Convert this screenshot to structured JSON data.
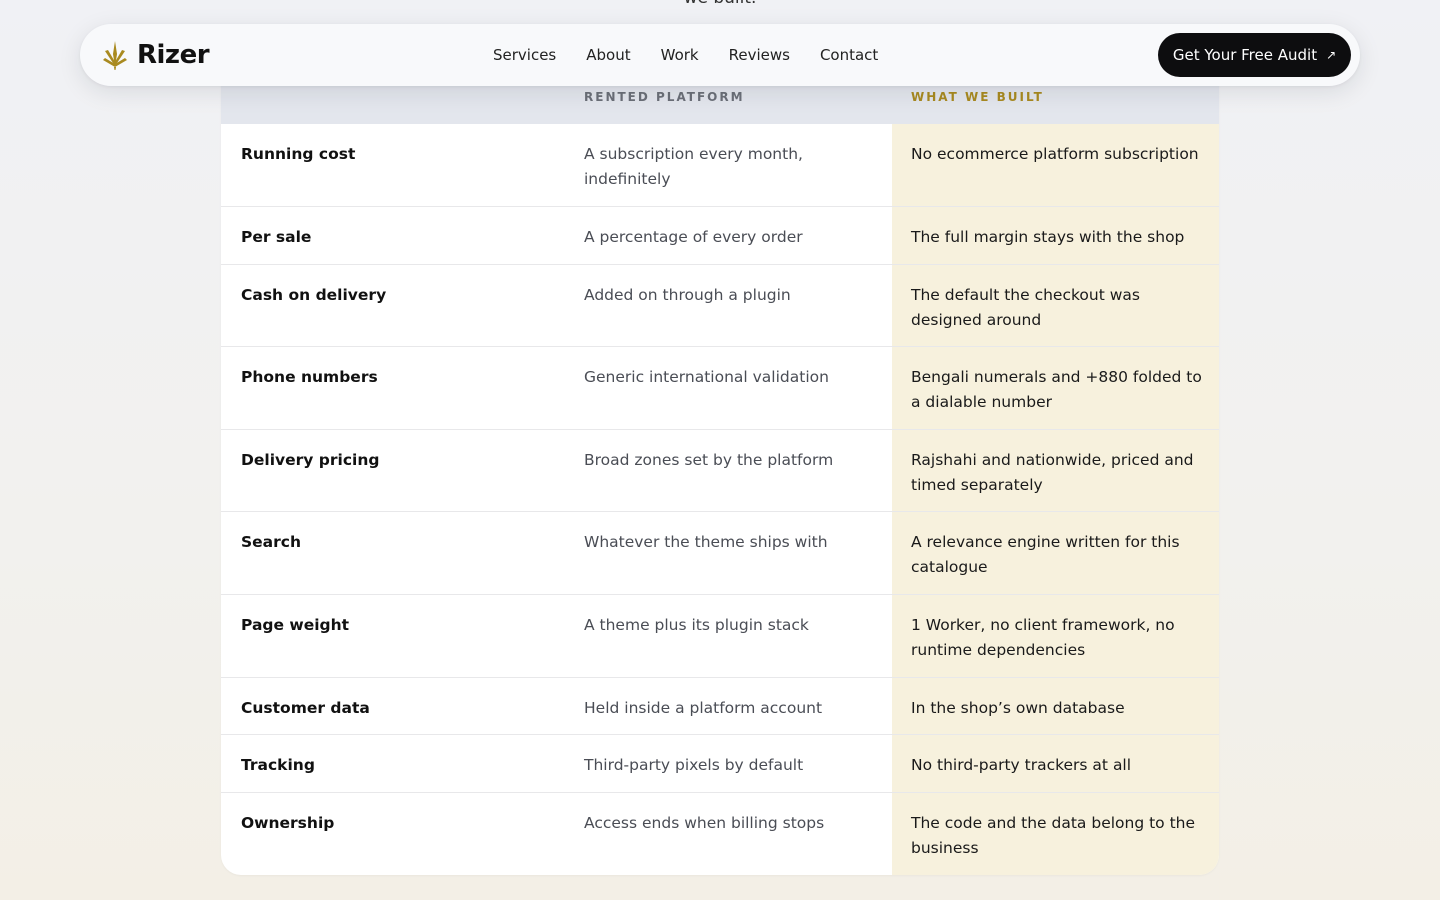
{
  "top_partial_text": "we built.",
  "navbar": {
    "brand": "Rizer",
    "links": [
      "Services",
      "About",
      "Work",
      "Reviews",
      "Contact"
    ],
    "cta_label": "Get Your Free Audit",
    "cta_icon": "arrow-up-right-icon"
  },
  "table": {
    "headers": {
      "label": "",
      "rented": "RENTED PLATFORM",
      "built": "WHAT WE BUILT"
    },
    "rows": [
      {
        "label": "Running cost",
        "rented": "A subscription every month, indefinitely",
        "built": "No ecommerce platform subscription"
      },
      {
        "label": "Per sale",
        "rented": "A percentage of every order",
        "built": "The full margin stays with the shop"
      },
      {
        "label": "Cash on delivery",
        "rented": "Added on through a plugin",
        "built": "The default the checkout was designed around"
      },
      {
        "label": "Phone numbers",
        "rented": "Generic international validation",
        "built": "Bengali numerals and +880 folded to a dialable number"
      },
      {
        "label": "Delivery pricing",
        "rented": "Broad zones set by the platform",
        "built": "Rajshahi and nationwide, priced and timed separately"
      },
      {
        "label": "Search",
        "rented": "Whatever the theme ships with",
        "built": "A relevance engine written for this catalogue"
      },
      {
        "label": "Page weight",
        "rented": "A theme plus its plugin stack",
        "built": "1 Worker, no client framework, no runtime dependencies"
      },
      {
        "label": "Customer data",
        "rented": "Held inside a platform account",
        "built": "In the shop’s own database"
      },
      {
        "label": "Tracking",
        "rented": "Third-party pixels by default",
        "built": "No third-party trackers at all"
      },
      {
        "label": "Ownership",
        "rented": "Access ends when billing stops",
        "built": "The code and the data belong to the business"
      }
    ]
  },
  "colors": {
    "accent_gold": "#a98a20",
    "built_column_bg": "#f7f1dd",
    "header_bg": "#e3e6ed",
    "cta_bg": "#0d0d0f"
  }
}
